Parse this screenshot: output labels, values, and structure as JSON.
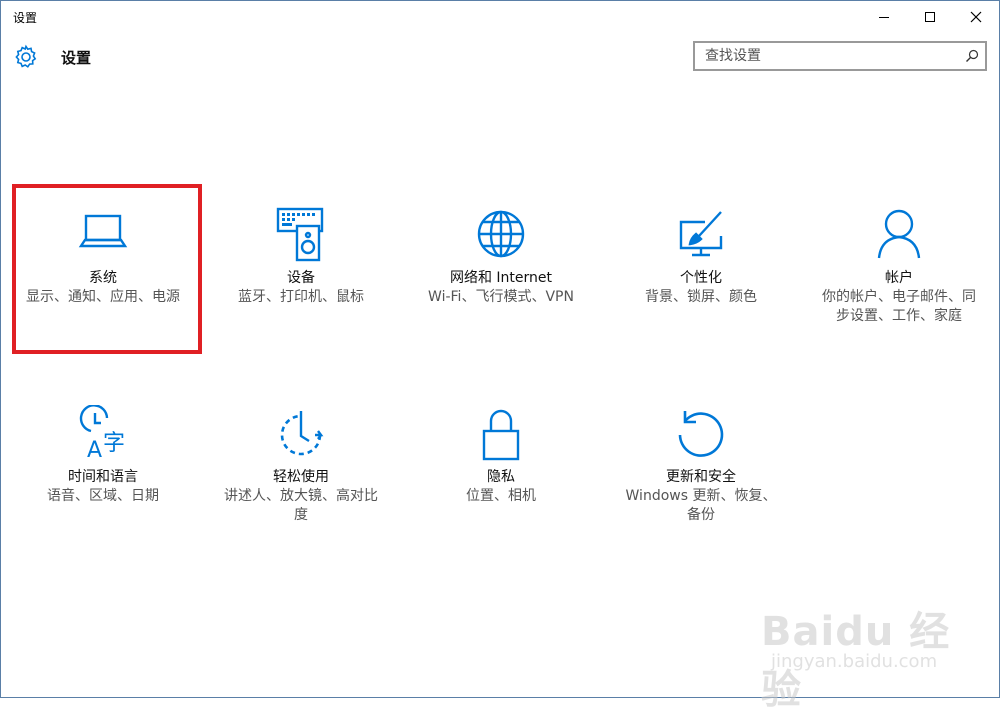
{
  "window": {
    "title": "设置"
  },
  "header": {
    "title": "设置",
    "gear_icon": "gear-icon"
  },
  "search": {
    "placeholder": "查找设置",
    "value": "",
    "icon": "search-icon"
  },
  "colors": {
    "accent": "#0078d7",
    "highlight_border": "#e02024",
    "description_text": "#555555",
    "title_text": "#111111"
  },
  "tiles": [
    {
      "title": "系统",
      "description": "显示、通知、应用、电源",
      "icon": "laptop-icon",
      "highlighted": true
    },
    {
      "title": "设备",
      "description": "蓝牙、打印机、鼠标",
      "icon": "keyboard-speaker-icon"
    },
    {
      "title": "网络和 Internet",
      "description": "Wi-Fi、飞行模式、VPN",
      "icon": "globe-icon"
    },
    {
      "title": "个性化",
      "description": "背景、锁屏、颜色",
      "icon": "paint-monitor-icon"
    },
    {
      "title": "帐户",
      "description": "你的帐户、电子邮件、同步设置、工作、家庭",
      "icon": "person-icon"
    },
    {
      "title": "时间和语言",
      "description": "语音、区域、日期",
      "icon": "clock-language-icon"
    },
    {
      "title": "轻松使用",
      "description": "讲述人、放大镜、高对比度",
      "icon": "ease-of-access-icon"
    },
    {
      "title": "隐私",
      "description": "位置、相机",
      "icon": "lock-icon"
    },
    {
      "title": "更新和安全",
      "description": "Windows 更新、恢复、备份",
      "icon": "refresh-icon"
    }
  ],
  "watermark": {
    "brand": "Baidu 经验",
    "url": "jingyan.baidu.com"
  }
}
